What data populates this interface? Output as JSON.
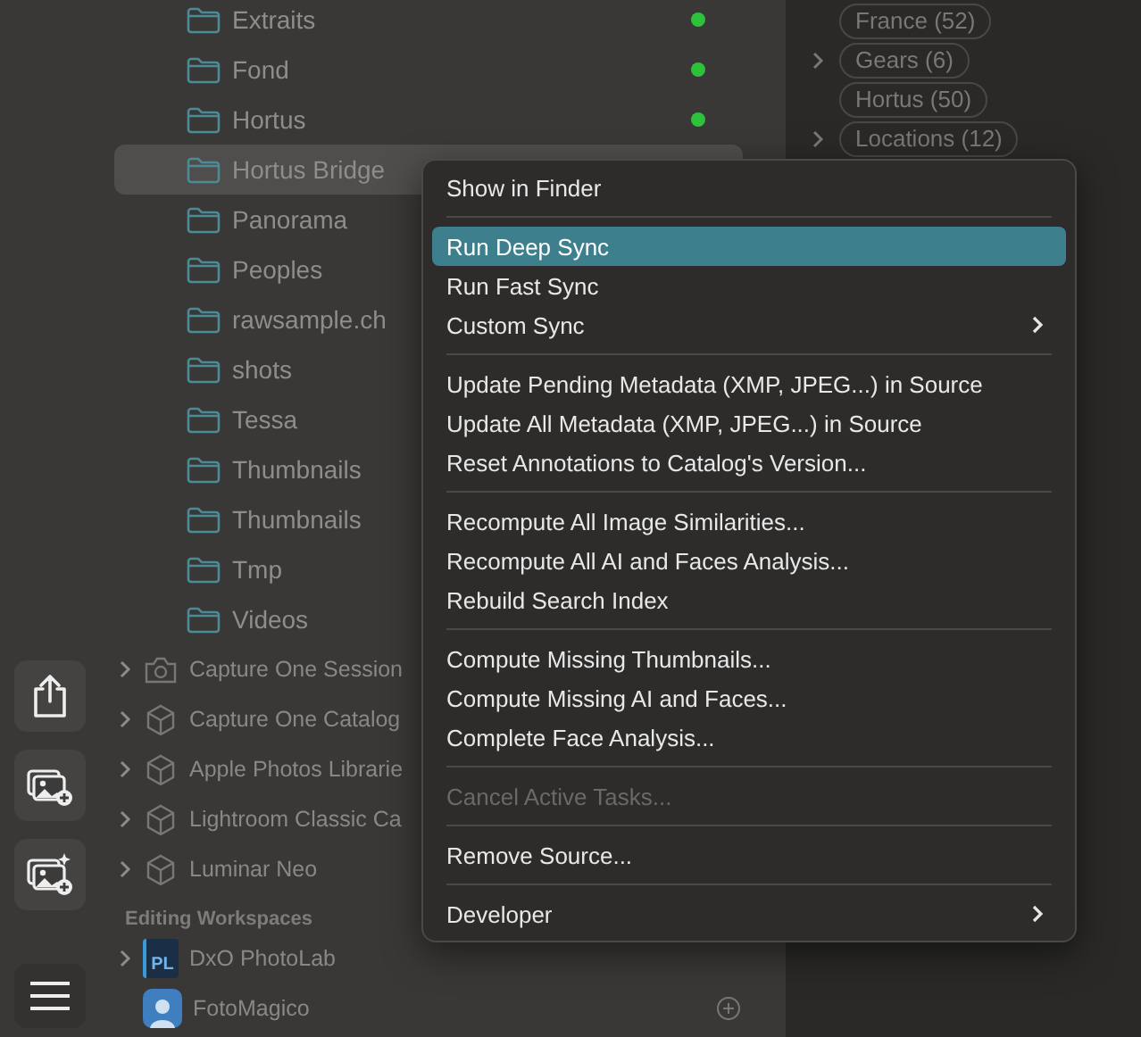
{
  "folders": [
    {
      "name": "Extraits",
      "synced": true,
      "selected": false
    },
    {
      "name": "Fond",
      "synced": true,
      "selected": false
    },
    {
      "name": "Hortus",
      "synced": true,
      "selected": false
    },
    {
      "name": "Hortus Bridge",
      "synced": false,
      "selected": true
    },
    {
      "name": "Panorama",
      "synced": false,
      "selected": false
    },
    {
      "name": "Peoples",
      "synced": false,
      "selected": false
    },
    {
      "name": "rawsample.ch",
      "synced": false,
      "selected": false
    },
    {
      "name": "shots",
      "synced": false,
      "selected": false
    },
    {
      "name": "Tessa",
      "synced": false,
      "selected": false
    },
    {
      "name": "Thumbnails",
      "synced": false,
      "selected": false
    },
    {
      "name": "Thumbnails",
      "synced": false,
      "selected": false
    },
    {
      "name": "Tmp",
      "synced": false,
      "selected": false
    },
    {
      "name": "Videos",
      "synced": false,
      "selected": false
    }
  ],
  "sources": [
    {
      "name": "Capture One Session",
      "kind": "camera"
    },
    {
      "name": "Capture One Catalog",
      "kind": "cube"
    },
    {
      "name": "Apple Photos Librarie",
      "kind": "cube"
    },
    {
      "name": "Lightroom Classic Ca",
      "kind": "cube"
    },
    {
      "name": "Luminar Neo",
      "kind": "cube"
    }
  ],
  "workspaces_header": "Editing Workspaces",
  "workspaces": [
    {
      "name": "DxO PhotoLab",
      "kind": "dxo",
      "icon_label": "PL",
      "expandable": true
    },
    {
      "name": "FotoMagico",
      "kind": "fotomagico",
      "expandable": false
    }
  ],
  "toolbar": [
    {
      "kind": "share"
    },
    {
      "kind": "add-photos"
    },
    {
      "kind": "add-photos-magic"
    },
    {
      "kind": "menu"
    }
  ],
  "tags": [
    {
      "label": "France (52)",
      "expandable": false
    },
    {
      "label": "Gears (6)",
      "expandable": true
    },
    {
      "label": "Hortus (50)",
      "expandable": false
    },
    {
      "label": "Locations (12)",
      "expandable": true
    }
  ],
  "context_menu": [
    {
      "kind": "item",
      "label": "Show in Finder",
      "selected": false,
      "disabled": false,
      "submenu": false
    },
    {
      "kind": "separator"
    },
    {
      "kind": "item",
      "label": "Run Deep Sync",
      "selected": true,
      "disabled": false,
      "submenu": false
    },
    {
      "kind": "item",
      "label": "Run Fast Sync",
      "selected": false,
      "disabled": false,
      "submenu": false
    },
    {
      "kind": "item",
      "label": "Custom Sync",
      "selected": false,
      "disabled": false,
      "submenu": true
    },
    {
      "kind": "separator"
    },
    {
      "kind": "item",
      "label": "Update Pending Metadata (XMP, JPEG...) in Source",
      "selected": false,
      "disabled": false,
      "submenu": false
    },
    {
      "kind": "item",
      "label": "Update All Metadata (XMP, JPEG...) in Source",
      "selected": false,
      "disabled": false,
      "submenu": false
    },
    {
      "kind": "item",
      "label": "Reset Annotations to Catalog's Version...",
      "selected": false,
      "disabled": false,
      "submenu": false
    },
    {
      "kind": "separator"
    },
    {
      "kind": "item",
      "label": "Recompute All Image Similarities...",
      "selected": false,
      "disabled": false,
      "submenu": false
    },
    {
      "kind": "item",
      "label": "Recompute All AI and Faces Analysis...",
      "selected": false,
      "disabled": false,
      "submenu": false
    },
    {
      "kind": "item",
      "label": "Rebuild Search Index",
      "selected": false,
      "disabled": false,
      "submenu": false
    },
    {
      "kind": "separator"
    },
    {
      "kind": "item",
      "label": "Compute Missing Thumbnails...",
      "selected": false,
      "disabled": false,
      "submenu": false
    },
    {
      "kind": "item",
      "label": "Compute Missing AI and Faces...",
      "selected": false,
      "disabled": false,
      "submenu": false
    },
    {
      "kind": "item",
      "label": "Complete Face Analysis...",
      "selected": false,
      "disabled": false,
      "submenu": false
    },
    {
      "kind": "separator"
    },
    {
      "kind": "item",
      "label": "Cancel Active Tasks...",
      "selected": false,
      "disabled": true,
      "submenu": false
    },
    {
      "kind": "separator"
    },
    {
      "kind": "item",
      "label": "Remove Source...",
      "selected": false,
      "disabled": false,
      "submenu": false
    },
    {
      "kind": "separator"
    },
    {
      "kind": "item",
      "label": "Developer",
      "selected": false,
      "disabled": false,
      "submenu": true
    }
  ]
}
